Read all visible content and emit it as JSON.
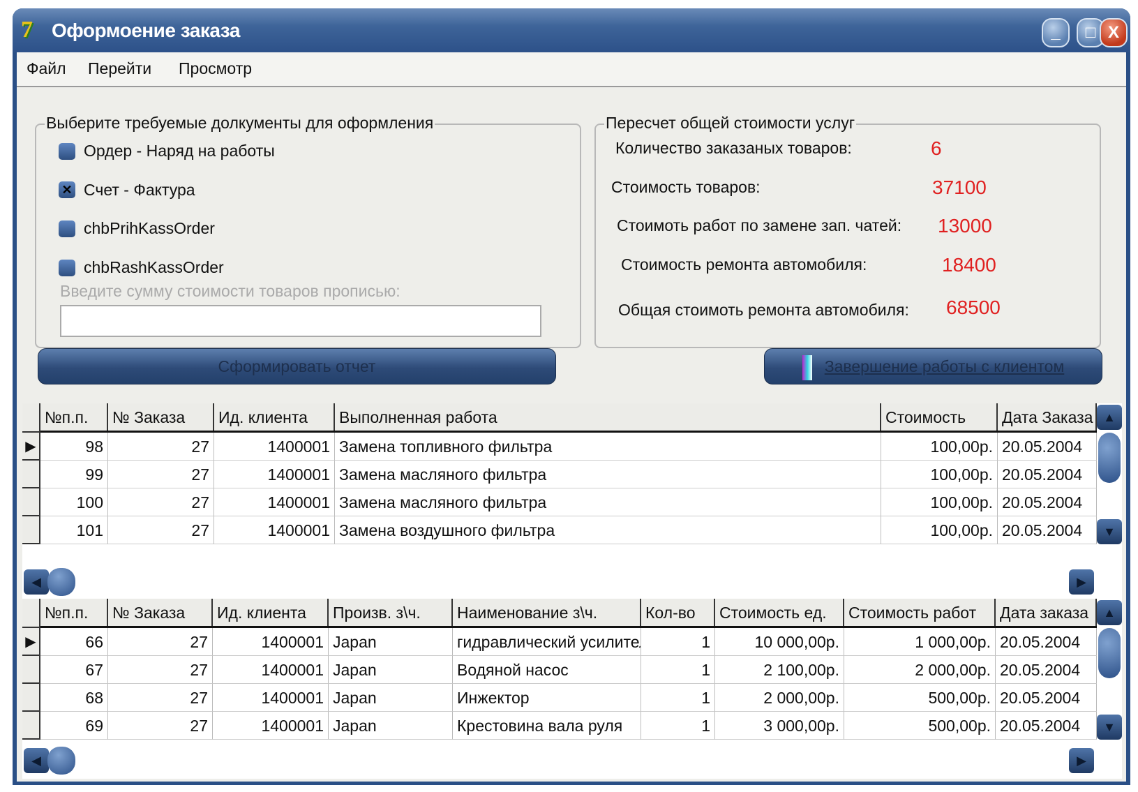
{
  "window": {
    "title": "Оформоение заказа",
    "logo": "7",
    "controls": {
      "minimize": "_",
      "maximize": "□",
      "close": "X"
    }
  },
  "menu": [
    "Файл",
    "Перейти",
    "Просмотр"
  ],
  "documents": {
    "legend": "Выберите требуемые долкументы для оформления",
    "checkboxes": [
      {
        "label": "Ордер - Наряд на работы",
        "checked": false
      },
      {
        "label": "Счет - Фактура",
        "checked": true
      },
      {
        "label": "chbPrihKassOrder",
        "checked": false
      },
      {
        "label": "chbRashKassOrder",
        "checked": false
      }
    ],
    "amount_label": "Введите сумму стоимости товаров прописью:",
    "amount_value": "",
    "report_button": "Сформировать отчет"
  },
  "summary": {
    "legend": "Пересчет общей стоимости услуг",
    "rows": [
      {
        "label": "Количество заказаных товаров:",
        "value": "6"
      },
      {
        "label": "Стоимость товаров:",
        "value": "37100"
      },
      {
        "label": "Стоимоть работ по замене зап. чатей:",
        "value": "13000"
      },
      {
        "label": "Стоимость ремонта автомобиля:",
        "value": "18400"
      },
      {
        "label": "Общая стоимоть ремонта  автомобиля:",
        "value": "68500"
      }
    ],
    "finish_button": "Завершение работы с клиентом"
  },
  "works_grid": {
    "columns": [
      "№п.п.",
      "№ Заказа",
      "Ид. клиента",
      "Выполненная работа",
      "Стоимость",
      "Дата Заказа"
    ],
    "rows": [
      [
        "98",
        "27",
        "1400001",
        "Замена топливного фильтра",
        "100,00р.",
        "20.05.2004"
      ],
      [
        "99",
        "27",
        "1400001",
        "Замена масляного фильтра",
        "100,00р.",
        "20.05.2004"
      ],
      [
        "100",
        "27",
        "1400001",
        "Замена масляного фильтра",
        "100,00р.",
        "20.05.2004"
      ],
      [
        "101",
        "27",
        "1400001",
        "Замена воздушного фильтра",
        "100,00р.",
        "20.05.2004"
      ]
    ]
  },
  "parts_grid": {
    "columns": [
      "№п.п.",
      "№ Заказа",
      "Ид. клиента",
      "Произв. з\\ч.",
      "Наименование з\\ч.",
      "Кол-во",
      "Стоимость ед.",
      "Стоимость работ",
      "Дата заказа"
    ],
    "rows": [
      [
        "66",
        "27",
        "1400001",
        "Japan",
        "гидравлический усилитель",
        "1",
        "10 000,00р.",
        "1 000,00р.",
        "20.05.2004"
      ],
      [
        "67",
        "27",
        "1400001",
        "Japan",
        "Водяной насос",
        "1",
        "2 100,00р.",
        "2 000,00р.",
        "20.05.2004"
      ],
      [
        "68",
        "27",
        "1400001",
        "Japan",
        "Инжектор",
        "1",
        "2 000,00р.",
        "500,00р.",
        "20.05.2004"
      ],
      [
        "69",
        "27",
        "1400001",
        "Japan",
        "Крестовина вала руля",
        "1",
        "3 000,00р.",
        "500,00р.",
        "20.05.2004"
      ]
    ]
  },
  "colors": {
    "accent": "#2d5189",
    "value_red": "#e02020"
  }
}
